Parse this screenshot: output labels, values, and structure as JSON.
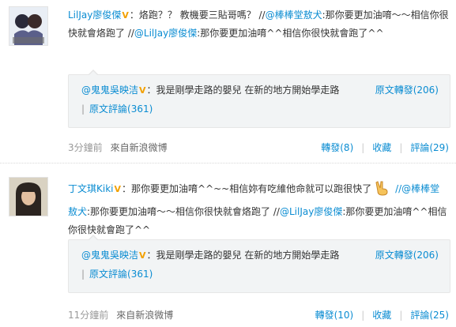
{
  "posts": [
    {
      "author": "LilJay廖俊傑",
      "v_badge": "V",
      "text_parts": [
        "：烙跑？？ 教機要三貼哥嗎？ //",
        "@棒棒堂敖犬",
        ":那你要更加油唷～～相信你很快就會烙跑了 //",
        "@LilJay廖俊傑",
        ":那你要更加油唷^^相信你很快就會跑了^^"
      ],
      "repost": {
        "author": "@鬼鬼吳映洁",
        "v_badge": "V",
        "text": "：我是剛學走路的嬰兒 在新的地方開始學走路",
        "original_repost": "原文轉發(206)",
        "original_comment": "原文評論(361)"
      },
      "time": "3分鐘前",
      "source": "來自新浪微博",
      "repost_label": "轉發(8)",
      "fav_label": "收藏",
      "comment_label": "評論(29)"
    },
    {
      "author": "丁文琪Kiki",
      "v_badge": "V",
      "text_parts": [
        "：那你要更加油唷^^~~相信妳有吃維他命就可以跑很快了",
        " //@",
        "棒棒堂敖犬",
        ":那你要更加油唷～～相信你很快就會烙跑了 //",
        "@LilJay廖俊傑",
        ":那你要更加油唷^^相信你很快就會跑了^^"
      ],
      "repost": {
        "author": "@鬼鬼吳映洁",
        "v_badge": "V",
        "text": "：我是剛學走路的嬰兒 在新的地方開始學走路",
        "original_repost": "原文轉發(206)",
        "original_comment": "原文評論(361)"
      },
      "time": "11分鐘前",
      "source": "來自新浪微博",
      "repost_label": "轉發(10)",
      "fav_label": "收藏",
      "comment_label": "評論(25)"
    }
  ],
  "icons": {
    "avatar_1": "avatar-liljay",
    "avatar_2": "avatar-kiki",
    "emoji": "peace-hand-emoji"
  }
}
